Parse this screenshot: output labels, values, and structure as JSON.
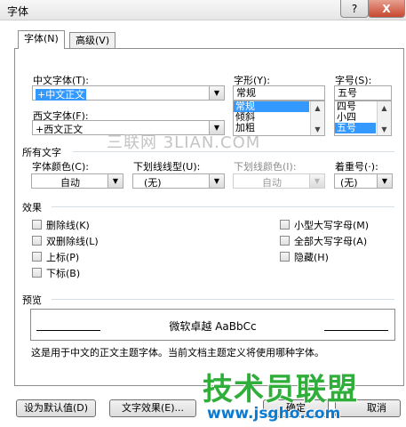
{
  "window": {
    "title": "字体",
    "help_glyph": "?",
    "close_glyph": "X"
  },
  "tabs": [
    {
      "label": "字体(N)"
    },
    {
      "label": "高级(V)"
    }
  ],
  "font": {
    "chinese_font_label": "中文字体(T):",
    "chinese_font_value": "+中文正文",
    "western_font_label": "西文字体(F):",
    "western_font_value": "+西文正文",
    "style_label": "字形(Y):",
    "style_value": "常规",
    "style_options": [
      "常规",
      "倾斜",
      "加粗"
    ],
    "size_label": "字号(S):",
    "size_value": "五号",
    "size_options": [
      "四号",
      "小四",
      "五号"
    ]
  },
  "all_text": {
    "section_label": "所有文字",
    "font_color_label": "字体颜色(C):",
    "font_color_value": "自动",
    "underline_type_label": "下划线线型(U):",
    "underline_type_value": "(无)",
    "underline_color_label": "下划线颜色(I):",
    "underline_color_value": "自动",
    "emphasis_label": "着重号(·):",
    "emphasis_value": "(无)"
  },
  "effects": {
    "section_label": "效果",
    "left": [
      "删除线(K)",
      "双删除线(L)",
      "上标(P)",
      "下标(B)"
    ],
    "right": [
      "小型大写字母(M)",
      "全部大写字母(A)",
      "隐藏(H)"
    ]
  },
  "preview": {
    "section_label": "预览",
    "sample_text": "微软卓越 AaBbCc",
    "description": "这是用于中文的正文主题字体。当前文档主题定义将使用哪种字体。"
  },
  "buttons": {
    "set_default": "设为默认值(D)",
    "text_effects": "文字效果(E)...",
    "ok": "确定",
    "cancel": "取消"
  },
  "watermark": {
    "text": "三联网 3LIAN.COM"
  },
  "logo": {
    "text": "技术员联盟",
    "url": "www.jsgho.com"
  },
  "colors": {
    "selection": "#3399ff",
    "logo_green": "#2fae3a",
    "logo_blue": "#0a7bd1"
  }
}
